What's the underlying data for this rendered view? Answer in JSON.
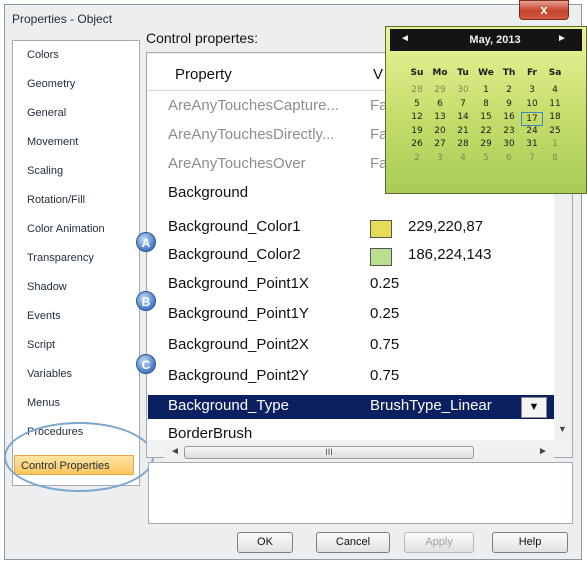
{
  "window": {
    "title": "Properties - Object",
    "close_glyph": "x"
  },
  "nav": {
    "items": [
      {
        "label": "Colors"
      },
      {
        "label": "Geometry"
      },
      {
        "label": "General"
      },
      {
        "label": "Movement"
      },
      {
        "label": "Scaling"
      },
      {
        "label": "Rotation/Fill"
      },
      {
        "label": "Color Animation"
      },
      {
        "label": "Transparency"
      },
      {
        "label": "Shadow"
      },
      {
        "label": "Events"
      },
      {
        "label": "Script"
      },
      {
        "label": "Variables"
      },
      {
        "label": "Menus"
      },
      {
        "label": "Procedures"
      },
      {
        "label": "Control Properties"
      }
    ],
    "active": "Control Properties"
  },
  "panel": {
    "label": "Control propertes:",
    "col_property": "Property",
    "col_value": "V",
    "rows": [
      {
        "name": "AreAnyTouchesCapture...",
        "value": "Fa"
      },
      {
        "name": "AreAnyTouchesDirectly...",
        "value": "Fa"
      },
      {
        "name": "AreAnyTouchesOver",
        "value": "Fa"
      },
      {
        "name": "Background",
        "value": ""
      },
      {
        "name": "Background_Color1",
        "value": "229,220,87",
        "swatch": "#e5dc57"
      },
      {
        "name": "Background_Color2",
        "value": "186,224,143",
        "swatch": "#bae08f"
      },
      {
        "name": "Background_Point1X",
        "value": "0.25"
      },
      {
        "name": "Background_Point1Y",
        "value": "0.25"
      },
      {
        "name": "Background_Point2X",
        "value": "0.75"
      },
      {
        "name": "Background_Point2Y",
        "value": "0.75"
      },
      {
        "name": "Background_Type",
        "value": "BrushType_Linear"
      },
      {
        "name": "BorderBrush",
        "value": ""
      }
    ],
    "dropdown_glyph": "▼",
    "scroll_thumb_glyph": "III"
  },
  "badges": [
    "A",
    "B",
    "C"
  ],
  "buttons": {
    "ok": "OK",
    "cancel": "Cancel",
    "apply": "Apply",
    "help": "Help"
  },
  "calendar": {
    "month": "May, 2013",
    "prev_glyph": "◄",
    "next_glyph": "►",
    "dow": [
      "Su",
      "Mo",
      "Tu",
      "We",
      "Th",
      "Fr",
      "Sa"
    ],
    "weeks": [
      [
        "28",
        "29",
        "30",
        "1",
        "2",
        "3",
        "4"
      ],
      [
        "5",
        "6",
        "7",
        "8",
        "9",
        "10",
        "11"
      ],
      [
        "12",
        "13",
        "14",
        "15",
        "16",
        "17",
        "18"
      ],
      [
        "19",
        "20",
        "21",
        "22",
        "23",
        "24",
        "25"
      ],
      [
        "26",
        "27",
        "28",
        "29",
        "30",
        "31",
        "1"
      ],
      [
        "2",
        "3",
        "4",
        "5",
        "6",
        "7",
        "8"
      ]
    ],
    "today": "17"
  },
  "colors": {
    "selected_row": "#0b2060",
    "swatch1": "#e5dc57",
    "swatch2": "#bae08f",
    "active_nav": "#fbc65e"
  }
}
